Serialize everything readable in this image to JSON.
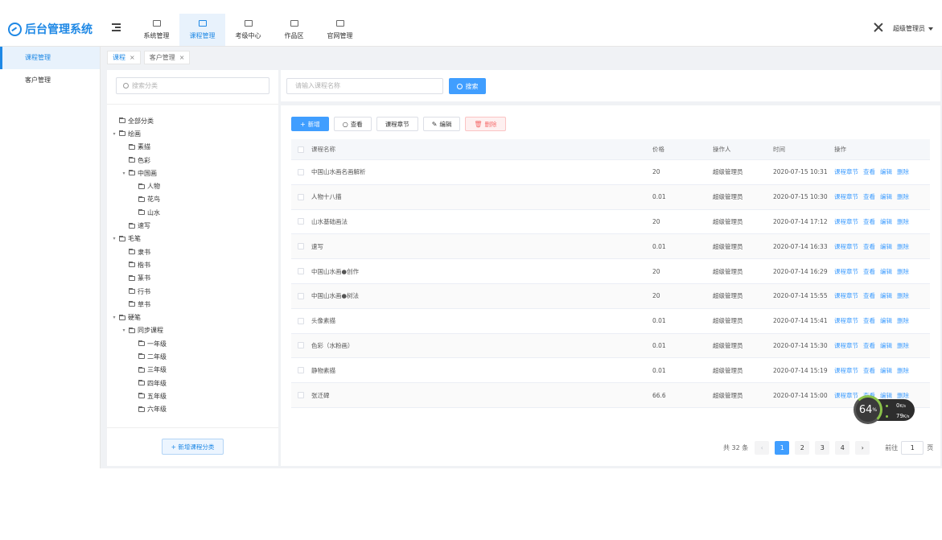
{
  "app": {
    "title": "后台管理系统"
  },
  "header": {
    "nav": [
      {
        "label": "系统管理",
        "active": false
      },
      {
        "label": "课程管理",
        "active": true
      },
      {
        "label": "考级中心",
        "active": false
      },
      {
        "label": "作品区",
        "active": false
      },
      {
        "label": "官网管理",
        "active": false
      }
    ],
    "user": "超级管理员"
  },
  "sidebar": {
    "items": [
      {
        "label": "课程管理",
        "active": true
      },
      {
        "label": "客户管理",
        "active": false
      }
    ]
  },
  "tabs": [
    {
      "label": "课程",
      "active": true
    },
    {
      "label": "客户管理",
      "active": false
    }
  ],
  "category": {
    "search_placeholder": "搜索分类",
    "add_button": "+ 新增课程分类",
    "tree": [
      {
        "label": "全部分类",
        "level": 0,
        "arrow": ""
      },
      {
        "label": "绘画",
        "level": 0,
        "arrow": "▾"
      },
      {
        "label": "素描",
        "level": 1,
        "arrow": ""
      },
      {
        "label": "色彩",
        "level": 1,
        "arrow": ""
      },
      {
        "label": "中国画",
        "level": 1,
        "arrow": "▾"
      },
      {
        "label": "人物",
        "level": 2,
        "arrow": ""
      },
      {
        "label": "花鸟",
        "level": 2,
        "arrow": ""
      },
      {
        "label": "山水",
        "level": 2,
        "arrow": ""
      },
      {
        "label": "速写",
        "level": 1,
        "arrow": ""
      },
      {
        "label": "毛笔",
        "level": 0,
        "arrow": "▾"
      },
      {
        "label": "隶书",
        "level": 1,
        "arrow": ""
      },
      {
        "label": "楷书",
        "level": 1,
        "arrow": ""
      },
      {
        "label": "篆书",
        "level": 1,
        "arrow": ""
      },
      {
        "label": "行书",
        "level": 1,
        "arrow": ""
      },
      {
        "label": "草书",
        "level": 1,
        "arrow": ""
      },
      {
        "label": "硬笔",
        "level": 0,
        "arrow": "▾"
      },
      {
        "label": "同步课程",
        "level": 1,
        "arrow": "▾"
      },
      {
        "label": "一年级",
        "level": 2,
        "arrow": ""
      },
      {
        "label": "二年级",
        "level": 2,
        "arrow": ""
      },
      {
        "label": "三年级",
        "level": 2,
        "arrow": ""
      },
      {
        "label": "四年级",
        "level": 2,
        "arrow": ""
      },
      {
        "label": "五年级",
        "level": 2,
        "arrow": ""
      },
      {
        "label": "六年级",
        "level": 2,
        "arrow": ""
      }
    ]
  },
  "course_search": {
    "placeholder": "请输入课程名称",
    "button": "搜索"
  },
  "toolbar": {
    "add": "新增",
    "view": "查看",
    "chapter": "课程章节",
    "edit": "编辑",
    "delete": "删除"
  },
  "table": {
    "headers": {
      "name": "课程名称",
      "price": "价格",
      "operator": "操作人",
      "time": "时间",
      "action": "操作"
    },
    "actions": [
      "课程章节",
      "查看",
      "编辑",
      "删除"
    ],
    "rows": [
      {
        "name": "中国山水画名画解析",
        "price": "20",
        "operator": "超级管理员",
        "time": "2020-07-15 10:31"
      },
      {
        "name": "人物十八描",
        "price": "0.01",
        "operator": "超级管理员",
        "time": "2020-07-15 10:30"
      },
      {
        "name": "山水基础画法",
        "price": "20",
        "operator": "超级管理员",
        "time": "2020-07-14 17:12"
      },
      {
        "name": "速写",
        "price": "0.01",
        "operator": "超级管理员",
        "time": "2020-07-14 16:33"
      },
      {
        "name": "中国山水画●创作",
        "price": "20",
        "operator": "超级管理员",
        "time": "2020-07-14 16:29"
      },
      {
        "name": "中国山水画●树法",
        "price": "20",
        "operator": "超级管理员",
        "time": "2020-07-14 15:55"
      },
      {
        "name": "头像素描",
        "price": "0.01",
        "operator": "超级管理员",
        "time": "2020-07-14 15:41"
      },
      {
        "name": "色彩（水粉画）",
        "price": "0.01",
        "operator": "超级管理员",
        "time": "2020-07-14 15:30"
      },
      {
        "name": "静物素描",
        "price": "0.01",
        "operator": "超级管理员",
        "time": "2020-07-14 15:19"
      },
      {
        "name": "张迁碑",
        "price": "66.6",
        "operator": "超级管理员",
        "time": "2020-07-14 15:00"
      }
    ]
  },
  "pagination": {
    "total": "共 32 条",
    "prev": "‹",
    "pages": [
      "1",
      "2",
      "3",
      "4"
    ],
    "current": "1",
    "next": "›",
    "goto_label": "前往",
    "goto_value": "1",
    "page_suffix": "页"
  },
  "speed_widget": {
    "percent": "64",
    "unit": "%",
    "up": "0",
    "down": "79",
    "rate_unit": "K/s"
  }
}
